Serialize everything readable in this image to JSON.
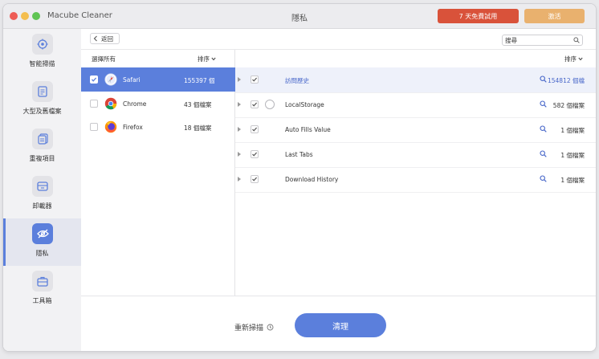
{
  "window": {
    "app_name": "Macube Cleaner",
    "title": "隱私",
    "trial_button": "7 天免費試用",
    "activate_button": "激活"
  },
  "sidebar": {
    "items": [
      {
        "label": "智能掃描",
        "icon": "smart-scan-icon"
      },
      {
        "label": "大型及舊檔案",
        "icon": "large-files-icon"
      },
      {
        "label": "重複項目",
        "icon": "duplicate-icon"
      },
      {
        "label": "卸載器",
        "icon": "uninstaller-icon"
      },
      {
        "label": "隱私",
        "icon": "privacy-icon",
        "active": true
      },
      {
        "label": "工具箱",
        "icon": "toolbox-icon"
      }
    ]
  },
  "toolbar": {
    "back_label": "返回",
    "search_placeholder": "搜尋"
  },
  "left_pane": {
    "select_all_label": "選擇所有",
    "sort_label": "排序",
    "browsers": [
      {
        "name": "Safari",
        "count": "155397 個",
        "selected": true,
        "checked": true,
        "icon": "safari-icon"
      },
      {
        "name": "Chrome",
        "count": "43 個檔案",
        "selected": false,
        "checked": false,
        "icon": "chrome-icon"
      },
      {
        "name": "Firefox",
        "count": "18 個檔案",
        "selected": false,
        "checked": false,
        "icon": "firefox-icon"
      }
    ]
  },
  "right_pane": {
    "sort_label": "排序",
    "items": [
      {
        "name": "訪問歷史",
        "count": "154812 個檔",
        "selected": true
      },
      {
        "name": "LocalStorage",
        "count": "582 個檔案",
        "selected": false
      },
      {
        "name": "Auto Fills Value",
        "count": "1 個檔案",
        "selected": false
      },
      {
        "name": "Last Tabs",
        "count": "1 個檔案",
        "selected": false
      },
      {
        "name": "Download History",
        "count": "1 個檔案",
        "selected": false
      }
    ]
  },
  "bottom": {
    "rescan_label": "重新掃描",
    "clean_button": "清理"
  },
  "colors": {
    "accent": "#5b7fdc",
    "trial": "#d9523a",
    "activate": "#e9b16e"
  }
}
